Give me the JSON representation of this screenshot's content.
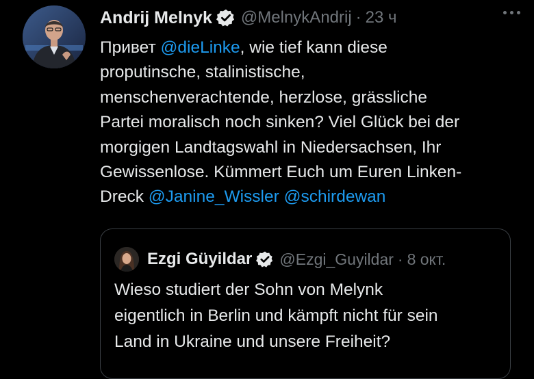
{
  "tweet": {
    "author_name": "Andrij Melnyk",
    "handle": "@MelnykAndrij",
    "separator": "·",
    "time": "23 ч",
    "lines": [
      {
        "pre": "Привет ",
        "mention": "@dieLinke",
        "post": ", wie tief kann diese"
      },
      {
        "text": "proputinsche, stalinistische,"
      },
      {
        "text": "menschenverachtende, herzlose, grässliche"
      },
      {
        "text": "Partei moralisch noch sinken? Viel Glück bei der"
      },
      {
        "text": "morgigen Landtagswahl in Niedersachsen, Ihr"
      },
      {
        "text": "Gewissenlose. Kümmert Euch um Euren Linken-"
      },
      {
        "pre": "Dreck ",
        "mention": "@Janine_Wissler",
        "mid": " ",
        "mention2": "@schirdewan"
      }
    ]
  },
  "quote": {
    "author_name": "Ezgi Güyildar",
    "handle": "@Ezgi_Guyildar",
    "separator": "·",
    "time": "8 окт.",
    "lines": [
      "Wieso studiert der Sohn von Melynk",
      "eigentlich in Berlin und kämpft nicht für sein",
      "Land in Ukraine und unsere Freiheit?"
    ]
  },
  "icons": {
    "verified": "verified-badge-icon",
    "more": "more-options-icon"
  },
  "colors": {
    "background": "#000000",
    "text": "#e7e9ea",
    "secondary": "#71767b",
    "link": "#1d9bf0",
    "border": "#3a3f44"
  }
}
